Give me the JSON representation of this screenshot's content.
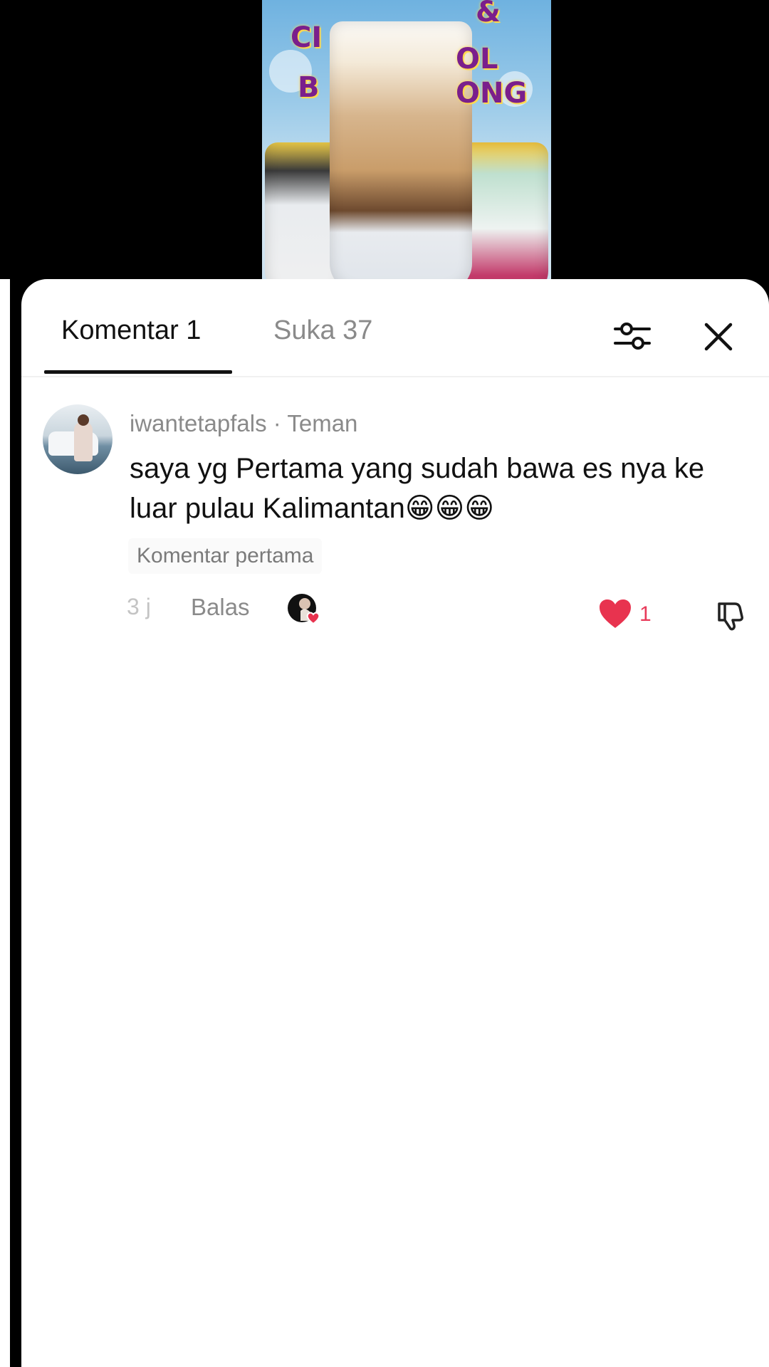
{
  "tabs": {
    "comments_label": "Komentar 1",
    "likes_label": "Suka 37"
  },
  "header_icons": {
    "filter": "sliders-icon",
    "close": "close-icon"
  },
  "comment": {
    "username": "iwantetapfals",
    "relation": "· Teman",
    "text": "saya yg Pertama yang sudah bawa es nya ke luar pulau Kalimantan😁😁😁",
    "badge": "Komentar pertama",
    "time": "3 j",
    "reply_label": "Balas",
    "like_count": "1",
    "like_color": "#e8334f"
  },
  "video": {
    "logo_fragments": [
      "&",
      "CI",
      "OL",
      "B",
      "ONG"
    ]
  }
}
